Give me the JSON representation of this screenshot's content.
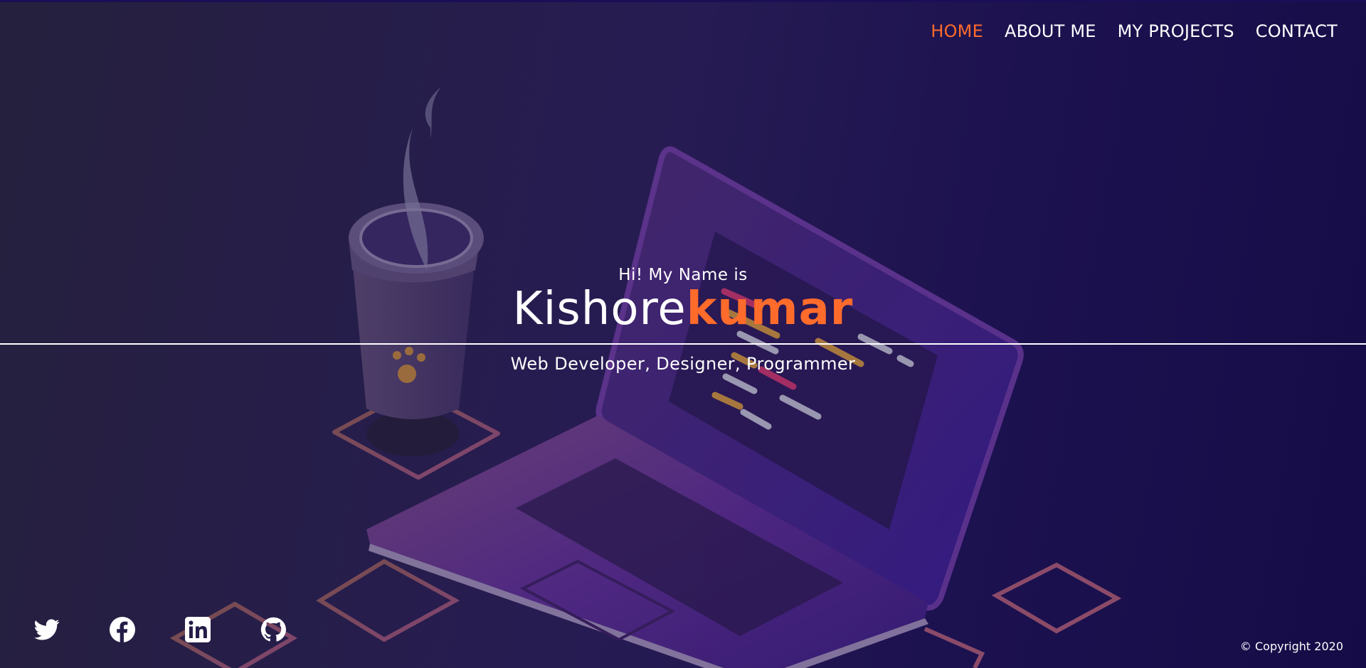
{
  "nav": {
    "items": [
      {
        "label": "HOME",
        "active": true
      },
      {
        "label": "ABOUT ME",
        "active": false
      },
      {
        "label": "MY PROJECTS",
        "active": false
      },
      {
        "label": "CONTACT",
        "active": false
      }
    ]
  },
  "hero": {
    "greeting": "Hi! My Name is",
    "first_name": "Kishore",
    "last_name": "kumar",
    "roles": "Web Developer, Designer, Programmer"
  },
  "social": [
    "twitter-icon",
    "facebook-icon",
    "linkedin-icon",
    "github-icon"
  ],
  "footer": {
    "copyright": "© Copyright 2020"
  },
  "colors": {
    "accent": "#ff6b2b",
    "background": "#221a4a",
    "text": "#ffffff"
  }
}
